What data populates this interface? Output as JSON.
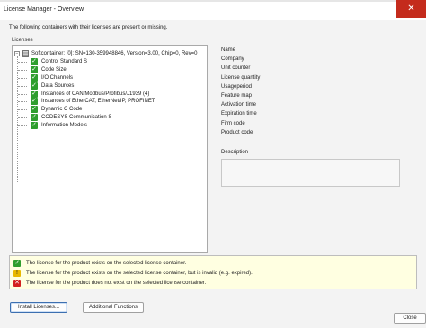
{
  "window": {
    "title": "License Manager - Overview",
    "close_glyph": "✕"
  },
  "subtitle": "The following containers with their licenses are present or missing.",
  "licenses_group": {
    "label": "Licenses",
    "root": {
      "expander": "−",
      "label": "Softcontainer: [0]: SN=130-359948846, Version=3.00, Chip=0, Rev=0"
    },
    "items": [
      {
        "label": "Control Standard S",
        "status": "ok"
      },
      {
        "label": "Code Size",
        "status": "ok"
      },
      {
        "label": "I/O Channels",
        "status": "ok"
      },
      {
        "label": "Data Sources",
        "status": "ok"
      },
      {
        "label": "Instances of CAN/Modbus/Profibus/J1939 (4)",
        "status": "ok"
      },
      {
        "label": "Instances of EtherCAT, EtherNet/IP, PROFINET",
        "status": "ok"
      },
      {
        "label": "Dynamic C Code",
        "status": "ok"
      },
      {
        "label": "CODESYS Communication S",
        "status": "ok"
      },
      {
        "label": "Information Models",
        "status": "ok"
      }
    ]
  },
  "properties": [
    "Name",
    "Company",
    "Unit counter",
    "License quantity",
    "Usageperiod",
    "Feature map",
    "Activation time",
    "Expiration time",
    "Firm code",
    "Product code"
  ],
  "description": {
    "label": "Description"
  },
  "legend": [
    {
      "icon": "check-icon",
      "text": "The license for the product exists on the selected license container."
    },
    {
      "icon": "warning-icon",
      "text": "The license for the product exists on the selected license container, but is invalid (e.g. expired)."
    },
    {
      "icon": "error-icon",
      "text": "The license for the product does not exist on the selected license container."
    }
  ],
  "buttons": {
    "install": "Install Licenses...",
    "additional": "Additional Functions",
    "close": "Close"
  },
  "colors": {
    "ok": "#2e9e2e",
    "warning": "#e8b800",
    "error": "#d32020",
    "legend_bg": "#ffffe1"
  }
}
